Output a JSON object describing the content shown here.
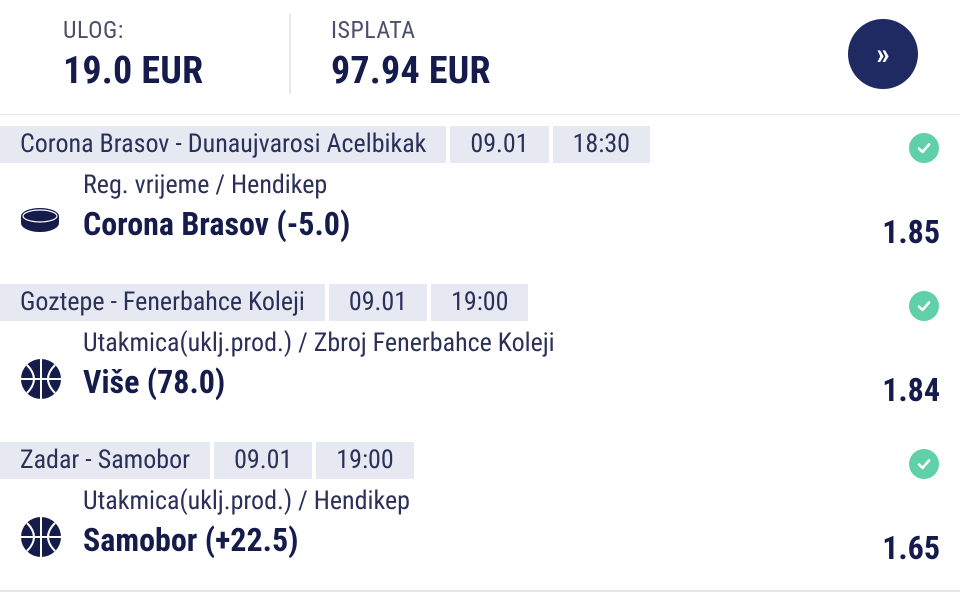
{
  "header": {
    "stake_label": "ULOG:",
    "stake_value": "19.0 EUR",
    "payout_label": "ISPLATA",
    "payout_value": "97.94 EUR",
    "next_icon": "double-chevron-right-icon",
    "next_glyph": "»"
  },
  "bets": [
    {
      "match": "Corona Brasov - Dunaujvarosi Acelbikak",
      "date": "09.01",
      "time": "18:30",
      "sport_icon": "hockey-puck-icon",
      "market": "Reg. vrijeme / Hendikep",
      "selection": "Corona Brasov (-5.0)",
      "odds": "1.85",
      "status_icon": "check-circle-icon"
    },
    {
      "match": "Goztepe - Fenerbahce Koleji",
      "date": "09.01",
      "time": "19:00",
      "sport_icon": "basketball-icon",
      "market": "Utakmica(uklj.prod.) / Zbroj Fenerbahce Koleji",
      "selection": "Više (78.0)",
      "odds": "1.84",
      "status_icon": "check-circle-icon"
    },
    {
      "match": "Zadar - Samobor",
      "date": "09.01",
      "time": "19:00",
      "sport_icon": "basketball-icon",
      "market": "Utakmica(uklj.prod.) / Hendikep",
      "selection": "Samobor (+22.5)",
      "odds": "1.65",
      "status_icon": "check-circle-icon"
    }
  ],
  "colors": {
    "navy": "#151c4c",
    "button": "#1f2a62",
    "chip_bg": "#e6e8f2",
    "check": "#5fd0a8"
  }
}
